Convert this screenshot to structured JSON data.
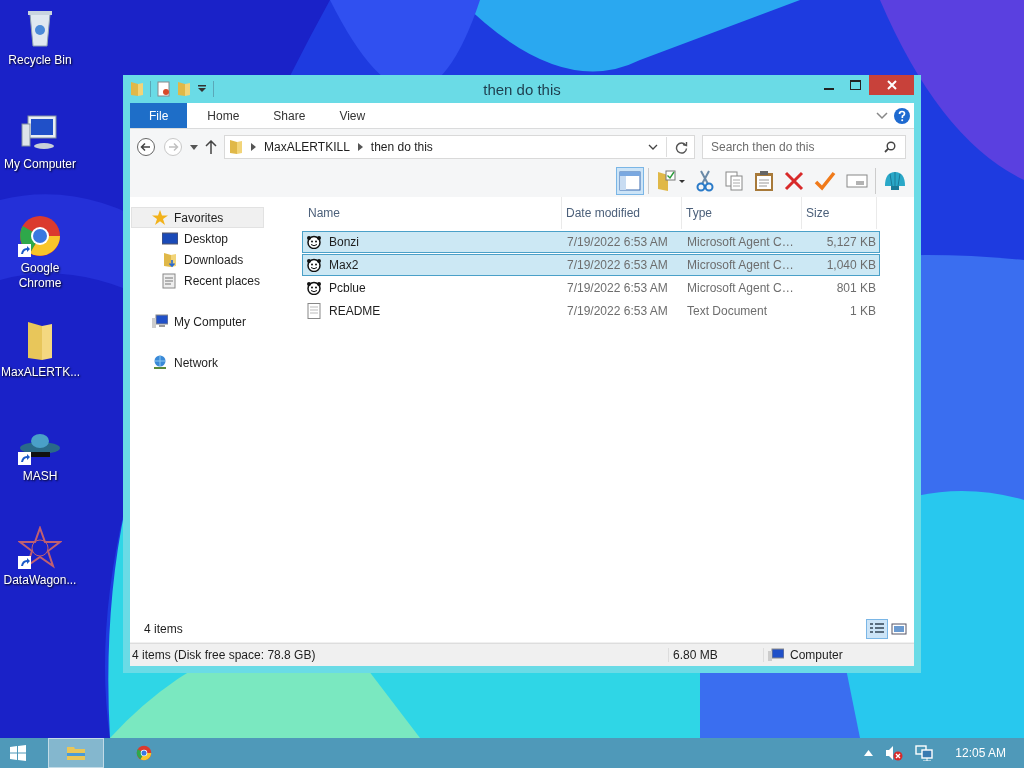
{
  "desktop_icons": [
    {
      "label": "Recycle Bin",
      "kind": "recycle",
      "shortcut": false
    },
    {
      "label": "My Computer",
      "kind": "computer",
      "shortcut": false
    },
    {
      "label": "Google Chrome",
      "kind": "chrome",
      "shortcut": true
    },
    {
      "label": "MaxALERTK...",
      "kind": "folder",
      "shortcut": false
    },
    {
      "label": "MASH",
      "kind": "ufo",
      "shortcut": true
    },
    {
      "label": "DataWagon...",
      "kind": "star",
      "shortcut": true
    }
  ],
  "window": {
    "title": "then do this",
    "ribbon_tabs": [
      {
        "label": "File",
        "selected": true
      },
      {
        "label": "Home",
        "selected": false
      },
      {
        "label": "Share",
        "selected": false
      },
      {
        "label": "View",
        "selected": false
      }
    ],
    "path": [
      "MaxALERTKILL",
      "then do this"
    ],
    "search": {
      "placeholder": "Search then do this"
    },
    "nav": [
      {
        "label": "Favorites",
        "kind": "star",
        "children": [
          {
            "label": "Desktop",
            "kind": "desktop"
          },
          {
            "label": "Downloads",
            "kind": "downloads"
          },
          {
            "label": "Recent places",
            "kind": "recent"
          }
        ]
      },
      {
        "label": "My Computer",
        "kind": "computer"
      },
      {
        "label": "Network",
        "kind": "network"
      }
    ],
    "columns": [
      "Name",
      "Date modified",
      "Type",
      "Size"
    ],
    "files": [
      {
        "name": "Bonzi",
        "date": "7/19/2022 6:53 AM",
        "type": "Microsoft Agent C…",
        "size": "5,127 KB",
        "kind": "agent",
        "selected": true
      },
      {
        "name": "Max2",
        "date": "7/19/2022 6:53 AM",
        "type": "Microsoft Agent C…",
        "size": "1,040 KB",
        "kind": "agent",
        "selected": true
      },
      {
        "name": "Pcblue",
        "date": "7/19/2022 6:53 AM",
        "type": "Microsoft Agent C…",
        "size": "801 KB",
        "kind": "agent",
        "selected": false
      },
      {
        "name": "README",
        "date": "7/19/2022 6:53 AM",
        "type": "Text Document",
        "size": "1 KB",
        "kind": "text",
        "selected": false
      }
    ],
    "item_count": "4 items",
    "status_bar": {
      "summary": "4 items (Disk free space: 78.8 GB)",
      "size": "6.80 MB",
      "location": "Computer"
    }
  },
  "taskbar": {
    "apps": [
      {
        "kind": "explorer",
        "selected": true
      },
      {
        "kind": "chrome",
        "selected": false
      }
    ],
    "clock": "12:05 AM"
  }
}
